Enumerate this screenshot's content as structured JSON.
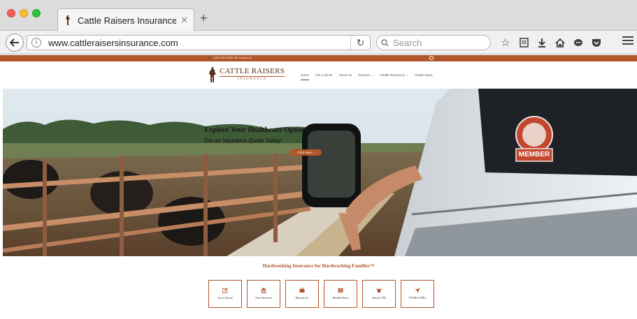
{
  "browser": {
    "tab": {
      "title": "Cattle Raisers Insurance – ...",
      "close": "✕"
    },
    "new_tab": "+",
    "url": "www.cattleraisersinsurance.com",
    "search_placeholder": "Search",
    "reload": "↻"
  },
  "site": {
    "topbar": {
      "contact": "📞 1-800-252-8405 | ✉ Contact Us"
    },
    "logo": {
      "main": "CATTLE RAISERS",
      "sub": "INSURANCE"
    },
    "nav": [
      {
        "label": "Home"
      },
      {
        "label": "Get a Quote"
      },
      {
        "label": "About Us"
      },
      {
        "label": "Services ⌄"
      },
      {
        "label": "Health Resources ⌄"
      },
      {
        "label": "Health News"
      }
    ],
    "hero": {
      "headline": "Explore Your Healthcare Options",
      "subhead": "Get an Insurance Quote Today!",
      "cta": "Click Here  ›",
      "sticker": "MEMBER"
    },
    "tagline": "Hardworking Insurance for Hardworking Families™",
    "tiles": [
      {
        "label": "Get a Quote",
        "icon": "edit-icon"
      },
      {
        "label": "Our Services",
        "icon": "building-icon"
      },
      {
        "label": "Resources",
        "icon": "briefcase-icon"
      },
      {
        "label": "Health News",
        "icon": "newspaper-icon"
      },
      {
        "label": "About CRI",
        "icon": "cow-icon"
      },
      {
        "label": "TSCRA.ORG",
        "icon": "send-icon"
      }
    ]
  },
  "colors": {
    "brand": "#b0562a",
    "brand_dark": "#5a2e1c"
  }
}
